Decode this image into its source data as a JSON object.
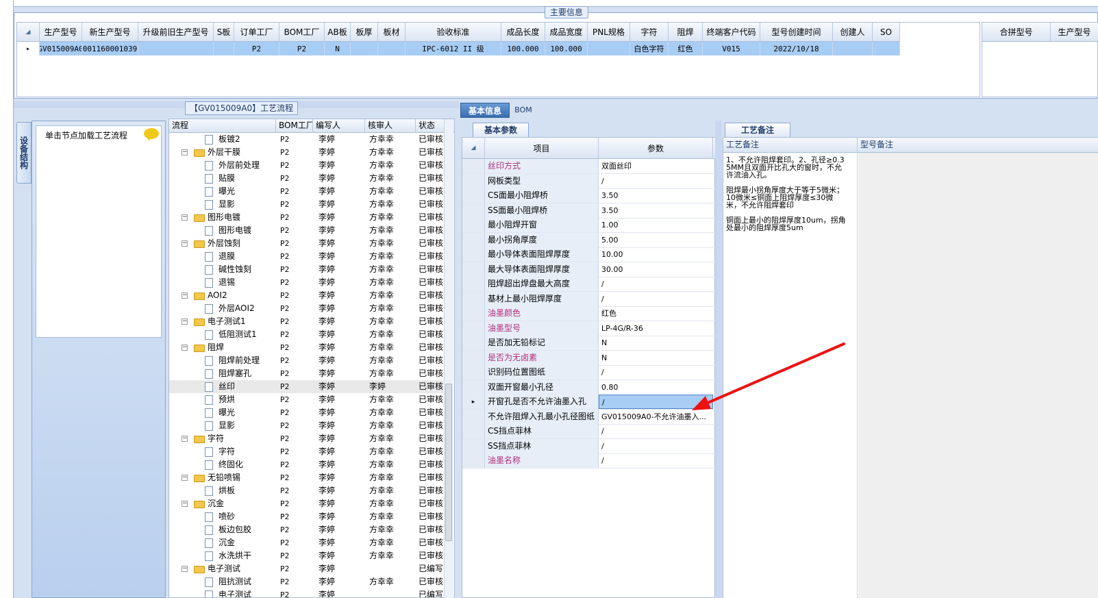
{
  "main_title": "主要信息",
  "main_grid": {
    "headers": [
      "生产型号",
      "新生产型号",
      "升级前旧生产型号",
      "S板",
      "订单工厂",
      "BOM工厂",
      "AB板",
      "板厚",
      "板材",
      "验收标准",
      "成品长度",
      "成品宽度",
      "PNL规格",
      "字符",
      "阻焊",
      "终端客户代码",
      "型号创建时间",
      "创建人",
      "SO"
    ],
    "row": [
      "GV015009A0",
      "10011600010391",
      "",
      "",
      "P2",
      "P2",
      "N",
      "",
      "",
      "IPC-6012 II 级",
      "100.000",
      "100.000",
      "",
      "白色字符",
      "红色",
      "V015",
      "2022/10/18",
      "",
      ""
    ]
  },
  "combo_grid": {
    "headers": [
      "合拼型号",
      "生产型号"
    ]
  },
  "process_title": "【GV015009A0】工艺流程",
  "side_tab": "设备结构",
  "load_hint": "单击节点加载工艺流程",
  "tree": {
    "headers": [
      "流程",
      "BOM工厂",
      "编写人",
      "核审人",
      "状态"
    ],
    "rows": [
      {
        "name": "板镀2",
        "level": 1,
        "bom": "P2",
        "writer": "李婷",
        "reviewer": "方幸幸",
        "status": "已审核"
      },
      {
        "name": "外层干膜",
        "level": 0,
        "bom": "P2",
        "writer": "李婷",
        "reviewer": "方幸幸",
        "status": "已审核"
      },
      {
        "name": "外层前处理",
        "level": 1,
        "bom": "P2",
        "writer": "李婷",
        "reviewer": "方幸幸",
        "status": "已审核"
      },
      {
        "name": "贴膜",
        "level": 1,
        "bom": "P2",
        "writer": "李婷",
        "reviewer": "方幸幸",
        "status": "已审核"
      },
      {
        "name": "曝光",
        "level": 1,
        "bom": "P2",
        "writer": "李婷",
        "reviewer": "方幸幸",
        "status": "已审核"
      },
      {
        "name": "显影",
        "level": 1,
        "bom": "P2",
        "writer": "李婷",
        "reviewer": "方幸幸",
        "status": "已审核"
      },
      {
        "name": "图形电镀",
        "level": 0,
        "bom": "P2",
        "writer": "李婷",
        "reviewer": "方幸幸",
        "status": "已审核"
      },
      {
        "name": "图形电镀",
        "level": 1,
        "bom": "P2",
        "writer": "李婷",
        "reviewer": "方幸幸",
        "status": "已审核"
      },
      {
        "name": "外层蚀刻",
        "level": 0,
        "bom": "P2",
        "writer": "李婷",
        "reviewer": "方幸幸",
        "status": "已审核"
      },
      {
        "name": "退膜",
        "level": 1,
        "bom": "P2",
        "writer": "李婷",
        "reviewer": "方幸幸",
        "status": "已审核"
      },
      {
        "name": "碱性蚀刻",
        "level": 1,
        "bom": "P2",
        "writer": "李婷",
        "reviewer": "方幸幸",
        "status": "已审核"
      },
      {
        "name": "退锡",
        "level": 1,
        "bom": "P2",
        "writer": "李婷",
        "reviewer": "方幸幸",
        "status": "已审核"
      },
      {
        "name": "AOI2",
        "level": 0,
        "bom": "P2",
        "writer": "李婷",
        "reviewer": "方幸幸",
        "status": "已审核"
      },
      {
        "name": "外层AOI2",
        "level": 1,
        "bom": "P2",
        "writer": "李婷",
        "reviewer": "方幸幸",
        "status": "已审核"
      },
      {
        "name": "电子测试1",
        "level": 0,
        "bom": "P2",
        "writer": "李婷",
        "reviewer": "方幸幸",
        "status": "已审核"
      },
      {
        "name": "低阻测试1",
        "level": 1,
        "bom": "P2",
        "writer": "李婷",
        "reviewer": "方幸幸",
        "status": "已审核"
      },
      {
        "name": "阻焊",
        "level": 0,
        "bom": "P2",
        "writer": "李婷",
        "reviewer": "方幸幸",
        "status": "已审核"
      },
      {
        "name": "阻焊前处理",
        "level": 1,
        "bom": "P2",
        "writer": "李婷",
        "reviewer": "方幸幸",
        "status": "已审核"
      },
      {
        "name": "阻焊塞孔",
        "level": 1,
        "bom": "P2",
        "writer": "李婷",
        "reviewer": "方幸幸",
        "status": "已审核"
      },
      {
        "name": "丝印",
        "level": 1,
        "bom": "P2",
        "writer": "李婷",
        "reviewer": "李婷",
        "status": "已审核",
        "selected": true
      },
      {
        "name": "预烘",
        "level": 1,
        "bom": "P2",
        "writer": "李婷",
        "reviewer": "方幸幸",
        "status": "已审核"
      },
      {
        "name": "曝光",
        "level": 1,
        "bom": "P2",
        "writer": "李婷",
        "reviewer": "方幸幸",
        "status": "已审核"
      },
      {
        "name": "显影",
        "level": 1,
        "bom": "P2",
        "writer": "李婷",
        "reviewer": "方幸幸",
        "status": "已审核"
      },
      {
        "name": "字符",
        "level": 0,
        "bom": "P2",
        "writer": "李婷",
        "reviewer": "方幸幸",
        "status": "已审核"
      },
      {
        "name": "字符",
        "level": 1,
        "bom": "P2",
        "writer": "李婷",
        "reviewer": "方幸幸",
        "status": "已审核"
      },
      {
        "name": "终固化",
        "level": 1,
        "bom": "P2",
        "writer": "李婷",
        "reviewer": "方幸幸",
        "status": "已审核"
      },
      {
        "name": "无铅喷锡",
        "level": 0,
        "bom": "P2",
        "writer": "李婷",
        "reviewer": "方幸幸",
        "status": "已审核"
      },
      {
        "name": "烘板",
        "level": 1,
        "bom": "P2",
        "writer": "李婷",
        "reviewer": "方幸幸",
        "status": "已审核"
      },
      {
        "name": "沉金",
        "level": 0,
        "bom": "P2",
        "writer": "李婷",
        "reviewer": "方幸幸",
        "status": "已审核"
      },
      {
        "name": "喷砂",
        "level": 1,
        "bom": "P2",
        "writer": "李婷",
        "reviewer": "方幸幸",
        "status": "已审核"
      },
      {
        "name": "板边包胶",
        "level": 1,
        "bom": "P2",
        "writer": "李婷",
        "reviewer": "方幸幸",
        "status": "已审核"
      },
      {
        "name": "沉金",
        "level": 1,
        "bom": "P2",
        "writer": "李婷",
        "reviewer": "方幸幸",
        "status": "已审核"
      },
      {
        "name": "水洗烘干",
        "level": 1,
        "bom": "P2",
        "writer": "李婷",
        "reviewer": "方幸幸",
        "status": "已审核"
      },
      {
        "name": "电子测试",
        "level": 0,
        "bom": "P2",
        "writer": "李婷",
        "reviewer": "",
        "status": "已编写"
      },
      {
        "name": "阻抗测试",
        "level": 1,
        "bom": "P2",
        "writer": "李婷",
        "reviewer": "方幸幸",
        "status": "已审核"
      },
      {
        "name": "电子测试",
        "level": 1,
        "bom": "P2",
        "writer": "李婷",
        "reviewer": "",
        "status": "已编写"
      }
    ]
  },
  "tabs": {
    "basic": "基本信息",
    "bom": "BOM"
  },
  "basic_params": {
    "tab": "基本参数",
    "headers": [
      "项目",
      "参数"
    ],
    "rows": [
      {
        "item": "丝印方式",
        "value": "双面丝印",
        "pink": true
      },
      {
        "item": "网板类型",
        "value": "/"
      },
      {
        "item": "CS面最小阻焊桥",
        "value": "3.50"
      },
      {
        "item": "SS面最小阻焊桥",
        "value": "3.50"
      },
      {
        "item": "最小阻焊开窗",
        "value": "1.00"
      },
      {
        "item": "最小拐角厚度",
        "value": "5.00"
      },
      {
        "item": "最小导体表面阻焊厚度",
        "value": "10.00"
      },
      {
        "item": "最大导体表面阻焊厚度",
        "value": "30.00"
      },
      {
        "item": "阻焊超出焊盘最大高度",
        "value": "/"
      },
      {
        "item": "基材上最小阻焊厚度",
        "value": "/"
      },
      {
        "item": "油墨颜色",
        "value": "红色",
        "pink": true
      },
      {
        "item": "油墨型号",
        "value": "LP-4G/R-36",
        "pink": true
      },
      {
        "item": "是否加无铅标记",
        "value": "N"
      },
      {
        "item": "是否为无卤素",
        "value": "N",
        "pink": true
      },
      {
        "item": "识别码位置图纸",
        "value": "/"
      },
      {
        "item": "双面开窗最小孔径",
        "value": "0.80"
      },
      {
        "item": "开窗孔是否不允许油墨入孔",
        "value": "/",
        "current": true
      },
      {
        "item": "不允许阻焊入孔最小孔径图纸",
        "value": "GV015009A0-不允许油墨入..."
      },
      {
        "item": "CS挡点菲林",
        "value": "/"
      },
      {
        "item": "SS挡点菲林",
        "value": "/"
      },
      {
        "item": "油墨名称",
        "value": "/",
        "pink": true
      }
    ]
  },
  "process_notes": {
    "tab": "工艺备注",
    "headers": [
      "工艺备注",
      "型号备注"
    ],
    "text": "1、不允许阻焊套印。2、孔径≥0.35MM且双面开比孔大的窗时，不允许流油入孔。\n\n阻焊最小拐角厚度大于等于5微米；10微米≤铜面上阻焊厚度≤30微米，不允许阻焊套印\n\n铜面上最小的阻焊厚度10um，拐角处最小的阻焊厚度5um"
  }
}
